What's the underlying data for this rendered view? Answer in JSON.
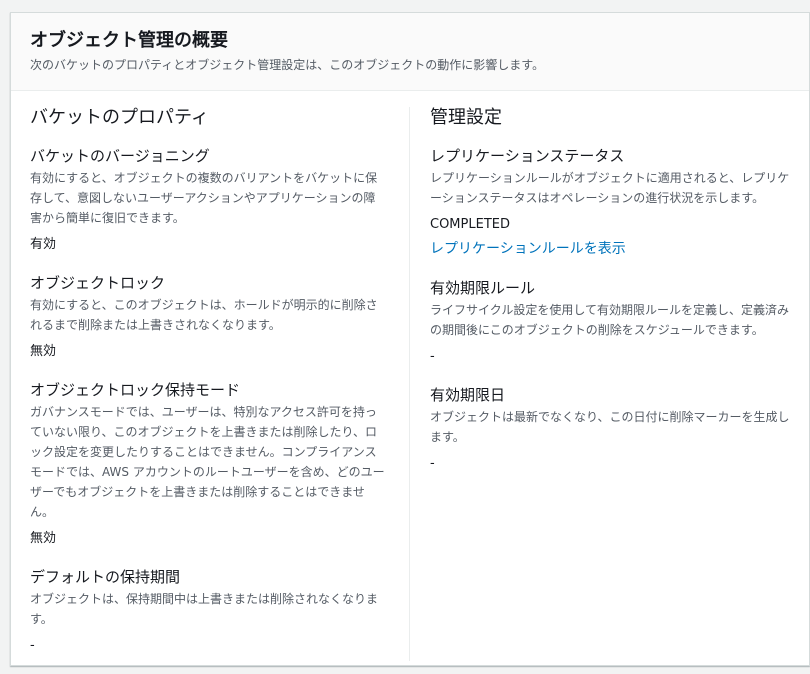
{
  "header": {
    "title": "オブジェクト管理の概要",
    "description": "次のバケットのプロパティとオブジェクト管理設定は、このオブジェクトの動作に影響します。"
  },
  "bucket_properties": {
    "heading": "バケットのプロパティ",
    "items": [
      {
        "label": "バケットのバージョニング",
        "description": "有効にすると、オブジェクトの複数のバリアントをバケットに保存して、意図しないユーザーアクションやアプリケーションの障害から簡単に復旧できます。",
        "value": "有効"
      },
      {
        "label": "オブジェクトロック",
        "description": "有効にすると、このオブジェクトは、ホールドが明示的に削除されるまで削除または上書きされなくなります。",
        "value": "無効"
      },
      {
        "label": "オブジェクトロック保持モード",
        "description": "ガバナンスモードでは、ユーザーは、特別なアクセス許可を持っていない限り、このオブジェクトを上書きまたは削除したり、ロック設定を変更したりすることはできません。コンプライアンスモードでは、AWS アカウントのルートユーザーを含め、どのユーザーでもオブジェクトを上書きまたは削除することはできません。",
        "value": "無効"
      },
      {
        "label": "デフォルトの保持期間",
        "description": "オブジェクトは、保持期間中は上書きまたは削除されなくなります。",
        "value": "-"
      }
    ]
  },
  "management": {
    "heading": "管理設定",
    "replication": {
      "label": "レプリケーションステータス",
      "description": "レプリケーションルールがオブジェクトに適用されると、レプリケーションステータスはオペレーションの進行状況を示します。",
      "value": "COMPLETED",
      "link": "レプリケーションルールを表示"
    },
    "expiration_rule": {
      "label": "有効期限ルール",
      "description": "ライフサイクル設定を使用して有効期限ルールを定義し、定義済みの期間後にこのオブジェクトの削除をスケジュールできます。",
      "value": "-"
    },
    "expiration_date": {
      "label": "有効期限日",
      "description": "オブジェクトは最新でなくなり、この日付に削除マーカーを生成します。",
      "value": "-"
    }
  },
  "colors": {
    "link": "#0073bb",
    "text": "#16191f",
    "secondary_text": "#545b64",
    "border": "#eaeded"
  }
}
